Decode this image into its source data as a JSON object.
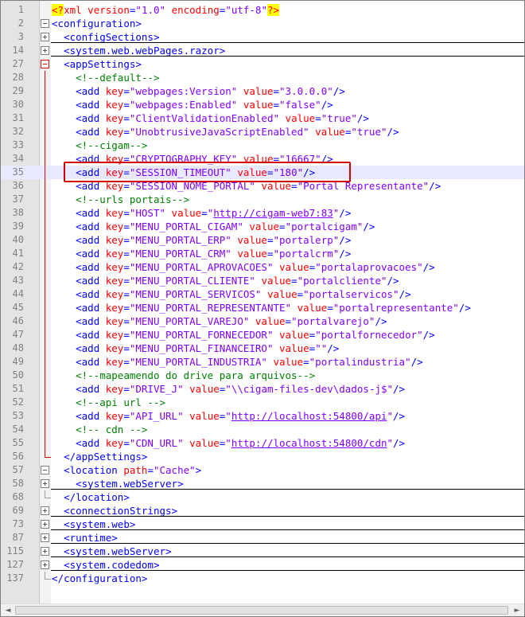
{
  "editor": {
    "highlighted_line": "35",
    "lines": [
      {
        "num": "1",
        "text": "<?xml version=\"1.0\" encoding=\"utf-8\"?>"
      },
      {
        "num": "2",
        "text": "<configuration>"
      },
      {
        "num": "3",
        "text": "  <configSections>"
      },
      {
        "num": "14",
        "text": "  <system.web.webPages.razor>"
      },
      {
        "num": "27",
        "text": "  <appSettings>"
      },
      {
        "num": "28",
        "text": "    <!--default-->"
      },
      {
        "num": "29",
        "text": "    <add key=\"webpages:Version\" value=\"3.0.0.0\"/>"
      },
      {
        "num": "30",
        "text": "    <add key=\"webpages:Enabled\" value=\"false\"/>"
      },
      {
        "num": "31",
        "text": "    <add key=\"ClientValidationEnabled\" value=\"true\"/>"
      },
      {
        "num": "32",
        "text": "    <add key=\"UnobtrusiveJavaScriptEnabled\" value=\"true\"/>"
      },
      {
        "num": "33",
        "text": "    <!--cigam-->"
      },
      {
        "num": "34",
        "text": "    <add key=\"CRYPTOGRAPHY_KEY\" value=\"16667\"/>"
      },
      {
        "num": "35",
        "text": "    <add key=\"SESSION_TIMEOUT\" value=\"180\"/>"
      },
      {
        "num": "36",
        "text": "    <add key=\"SESSION_NOME_PORTAL\" value=\"Portal Representante\"/>"
      },
      {
        "num": "37",
        "text": "    <!--urls portais-->"
      },
      {
        "num": "38",
        "text": "    <add key=\"HOST\" value=\"http://cigam-web7:83\"/>"
      },
      {
        "num": "39",
        "text": "    <add key=\"MENU_PORTAL_CIGAM\" value=\"portalcigam\"/>"
      },
      {
        "num": "40",
        "text": "    <add key=\"MENU_PORTAL_ERP\" value=\"portalerp\"/>"
      },
      {
        "num": "41",
        "text": "    <add key=\"MENU_PORTAL_CRM\" value=\"portalcrm\"/>"
      },
      {
        "num": "42",
        "text": "    <add key=\"MENU_PORTAL_APROVACOES\" value=\"portalaprovacoes\"/>"
      },
      {
        "num": "43",
        "text": "    <add key=\"MENU_PORTAL_CLIENTE\" value=\"portalcliente\"/>"
      },
      {
        "num": "44",
        "text": "    <add key=\"MENU_PORTAL_SERVICOS\" value=\"portalservicos\"/>"
      },
      {
        "num": "45",
        "text": "    <add key=\"MENU_PORTAL_REPRESENTANTE\" value=\"portalrepresentante\"/>"
      },
      {
        "num": "46",
        "text": "    <add key=\"MENU_PORTAL_VAREJO\" value=\"portalvarejo\"/>"
      },
      {
        "num": "47",
        "text": "    <add key=\"MENU_PORTAL_FORNECEDOR\" value=\"portalfornecedor\"/>"
      },
      {
        "num": "48",
        "text": "    <add key=\"MENU_PORTAL_FINANCEIRO\" value=\"\"/>"
      },
      {
        "num": "49",
        "text": "    <add key=\"MENU_PORTAL_INDUSTRIA\" value=\"portalindustria\"/>"
      },
      {
        "num": "50",
        "text": "    <!--mapeamendo do drive para arquivos-->"
      },
      {
        "num": "51",
        "text": "    <add key=\"DRIVE_J\" value=\"\\\\cigam-files-dev\\dados-j$\"/>"
      },
      {
        "num": "52",
        "text": "    <!--api url -->"
      },
      {
        "num": "53",
        "text": "    <add key=\"API_URL\" value=\"http://localhost:54800/api\"/>"
      },
      {
        "num": "54",
        "text": "    <!-- cdn -->"
      },
      {
        "num": "55",
        "text": "    <add key=\"CDN_URL\" value=\"http://localhost:54800/cdn\"/>"
      },
      {
        "num": "56",
        "text": "  </appSettings>"
      },
      {
        "num": "57",
        "text": "  <location path=\"Cache\">"
      },
      {
        "num": "58",
        "text": "    <system.webServer>"
      },
      {
        "num": "68",
        "text": "  </location>"
      },
      {
        "num": "69",
        "text": "  <connectionStrings>"
      },
      {
        "num": "73",
        "text": "  <system.web>"
      },
      {
        "num": "87",
        "text": "  <runtime>"
      },
      {
        "num": "115",
        "text": "  <system.webServer>"
      },
      {
        "num": "127",
        "text": "  <system.codedom>"
      },
      {
        "num": "137",
        "text": "</configuration>"
      }
    ]
  },
  "scrollbar": {
    "left_arrow": "◄",
    "right_arrow": "►"
  },
  "colors": {
    "tag": "#0000ff",
    "attribute": "#ff0000",
    "value": "#8000ff",
    "comment": "#008000",
    "highlight_line": "#e8e8ff",
    "callout_box": "#d00000"
  }
}
